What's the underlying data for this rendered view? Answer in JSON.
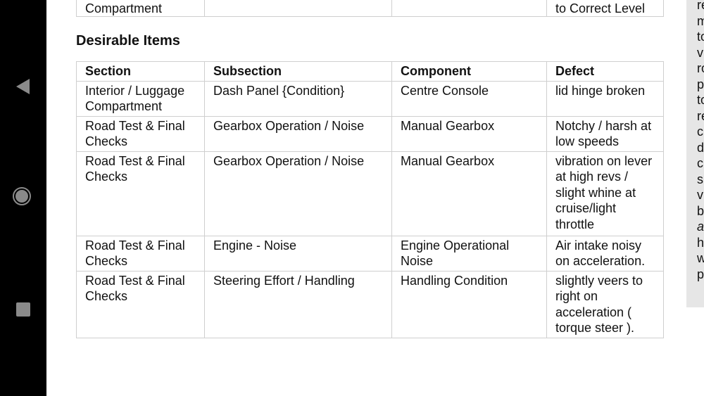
{
  "system_nav": {
    "back_icon": "back-triangle-icon",
    "home_icon": "home-circle-icon",
    "recents_icon": "recents-square-icon"
  },
  "previous_table": {
    "fragment_col1": "Compartment",
    "fragment_col4": "to Correct Level"
  },
  "section": {
    "title": "Desirable Items"
  },
  "table": {
    "headers": [
      "Section",
      "Subsection",
      "Component",
      "Defect"
    ],
    "rows": [
      [
        "Interior / Luggage Compartment",
        "Dash Panel {Condition}",
        "Centre Console",
        "lid hinge broken"
      ],
      [
        "Road Test & Final Checks",
        "Gearbox Operation / Noise",
        "Manual Gearbox",
        "Notchy / harsh at low speeds"
      ],
      [
        "Road Test & Final Checks",
        "Gearbox Operation / Noise",
        "Manual Gearbox",
        "vibration on lever at high revs / slight whine at cruise/light throttle"
      ],
      [
        "Road Test & Final Checks",
        "Engine - Noise",
        "Engine Operational Noise",
        "Air intake noisy on acceleration."
      ],
      [
        "Road Test & Final Checks",
        "Steering Effort / Handling",
        "Handling Condition",
        "slightly veers to right on acceleration ( torque steer )."
      ]
    ]
  },
  "side_panel": {
    "visible_fragments": [
      "re",
      "m",
      "to",
      "v",
      "ro",
      "p",
      "to",
      "re",
      "c",
      "d",
      "c",
      "s",
      "v",
      "b",
      "a",
      "h",
      "w",
      "p"
    ]
  }
}
